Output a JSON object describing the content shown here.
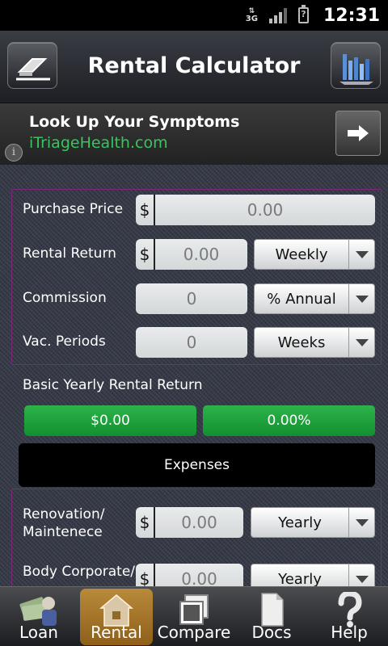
{
  "status": {
    "network": "3G",
    "time": "12:31"
  },
  "header": {
    "title": "Rental Calculator"
  },
  "ad": {
    "title": "Look Up Your Symptoms",
    "subtitle": "iTriageHealth.com"
  },
  "form": {
    "purchase_price": {
      "label": "Purchase Price",
      "currency": "$",
      "placeholder": "0.00"
    },
    "rental_return": {
      "label": "Rental Return",
      "currency": "$",
      "placeholder": "0.00",
      "period": "Weekly"
    },
    "commission": {
      "label": "Commission",
      "placeholder": "0",
      "period": "% Annual"
    },
    "vac_periods": {
      "label": "Vac. Periods",
      "placeholder": "0",
      "period": "Weeks"
    }
  },
  "summary": {
    "label": "Basic Yearly Rental Return",
    "amount": "$0.00",
    "percent": "0.00%"
  },
  "expenses": {
    "button_label": "Expenses",
    "renovation": {
      "label_line1": "Renovation/",
      "label_line2": "Maintenece",
      "currency": "$",
      "placeholder": "0.00",
      "period": "Yearly"
    },
    "body_corporate": {
      "label": "Body Corporate/",
      "currency": "$",
      "placeholder": "0.00",
      "period": "Yearly"
    }
  },
  "tabs": [
    {
      "label": "Loan",
      "icon": "money-icon"
    },
    {
      "label": "Rental",
      "icon": "house-icon"
    },
    {
      "label": "Compare",
      "icon": "windows-icon"
    },
    {
      "label": "Docs",
      "icon": "document-icon"
    },
    {
      "label": "Help",
      "icon": "question-icon"
    }
  ],
  "colors": {
    "accent_green": "#1ea23c",
    "ad_link": "#38c45e",
    "group_border": "#7a2a7a",
    "active_tab": "#a77428"
  }
}
